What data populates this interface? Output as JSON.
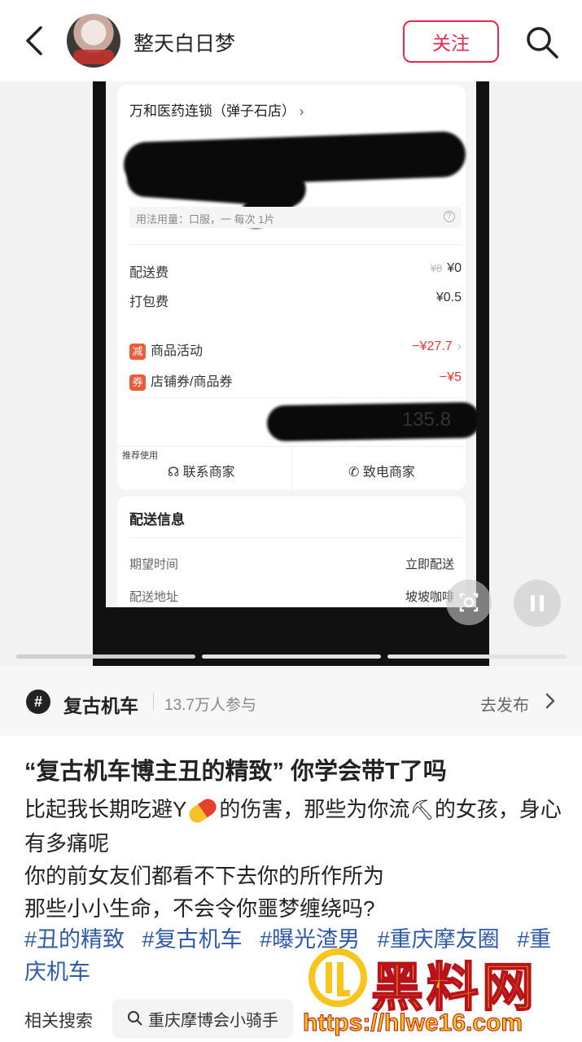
{
  "header": {
    "author": "整天白日梦",
    "follow_label": "关注"
  },
  "screenshot": {
    "store": "万和医药连锁（弹子石店）",
    "usage": "用法用量：口服，一    每次 1片",
    "fees": [
      {
        "label": "配送费",
        "strike": "¥8",
        "value": "¥0"
      },
      {
        "label": "打包费",
        "strike": "",
        "value": "¥0.5"
      }
    ],
    "discounts": [
      {
        "tag": "减",
        "label": "商品活动",
        "value": "−¥27.7"
      },
      {
        "tag": "券",
        "label": "店铺券/商品券",
        "value": "−¥5"
      }
    ],
    "total": "135.8",
    "recommend": "推荐使用",
    "contact": "联系商家",
    "call": "致电商家",
    "delivery_title": "配送信息",
    "delivery_rows": [
      {
        "k": "期望时间",
        "v": "立即配送"
      },
      {
        "k": "配送地址",
        "v": "坡坡咖啡"
      }
    ]
  },
  "topic": {
    "name": "复古机车",
    "count": "13.7万人参与",
    "go": "去发布"
  },
  "post": {
    "title": "“复古机车博主丑的精致” 你学会带T了吗",
    "line1a": "比起我长期吃避Y",
    "line1b": "的伤害，那些为你流",
    "line1c": "的女孩，身心有多痛呢",
    "line2": "你的前女友们都看不下去你的所作所为",
    "line3": "那些小小生命，不会令你噩梦缠绕吗?",
    "tags": [
      "#丑的精致",
      "#复古机车",
      "#曝光渣男",
      "#重庆摩友圈",
      "#重庆机车"
    ]
  },
  "related": {
    "label": "相关搜索",
    "query": "重庆摩博会小骑手"
  },
  "watermark": {
    "text": "黑料网",
    "url": "https://hlwe16.com"
  }
}
